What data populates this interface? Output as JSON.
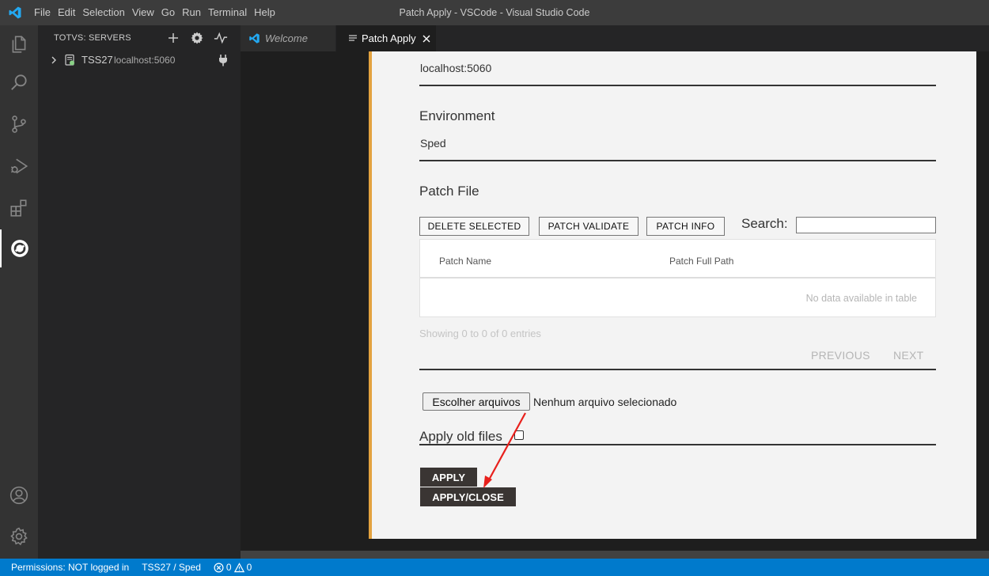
{
  "window": {
    "title": "Patch Apply - VSCode - Visual Studio Code",
    "menu": [
      "File",
      "Edit",
      "Selection",
      "View",
      "Go",
      "Run",
      "Terminal",
      "Help"
    ]
  },
  "activity": {
    "items": [
      "explorer-icon",
      "search-icon",
      "source-control-icon",
      "run-debug-icon",
      "extensions-icon",
      "totvs-icon"
    ],
    "bottom": [
      "account-icon",
      "manage-gear-icon"
    ],
    "active": "totvs-icon"
  },
  "sidebar": {
    "title": "TOTVS: SERVERS",
    "actions": [
      "add-icon",
      "gear-icon",
      "pulse-icon"
    ],
    "server": {
      "name": "TSS27",
      "address": "localhost:5060"
    }
  },
  "tabs": [
    {
      "label": "Welcome",
      "active": false
    },
    {
      "label": "Patch Apply",
      "active": true
    }
  ],
  "form": {
    "server_value": "localhost:5060",
    "environment_label": "Environment",
    "environment_value": "Sped",
    "patch_file_label": "Patch File",
    "buttons": {
      "delete_selected": "DELETE SELECTED",
      "patch_validate": "PATCH VALIDATE",
      "patch_info": "PATCH INFO"
    },
    "search_label": "Search:",
    "search_value": "",
    "table": {
      "columns": [
        "Patch Name",
        "Patch Full Path"
      ],
      "empty_text": "No data available in table",
      "info": "Showing 0 to 0 of 0 entries",
      "previous": "PREVIOUS",
      "next": "NEXT"
    },
    "file_button": "Escolher arquivos",
    "file_status": "Nenhum arquivo selecionado",
    "apply_old_label": "Apply old files",
    "apply_old_checked": false,
    "apply_button": "APPLY",
    "apply_close_button": "APPLY/CLOSE"
  },
  "statusbar": {
    "permissions": "Permissions: NOT logged in",
    "environment": "TSS27 / Sped",
    "errors": "0",
    "warnings": "0"
  },
  "colors": {
    "accent_status": "#007acc",
    "panel_border": "#e3a23f",
    "annotation_arrow": "#e8201c"
  }
}
